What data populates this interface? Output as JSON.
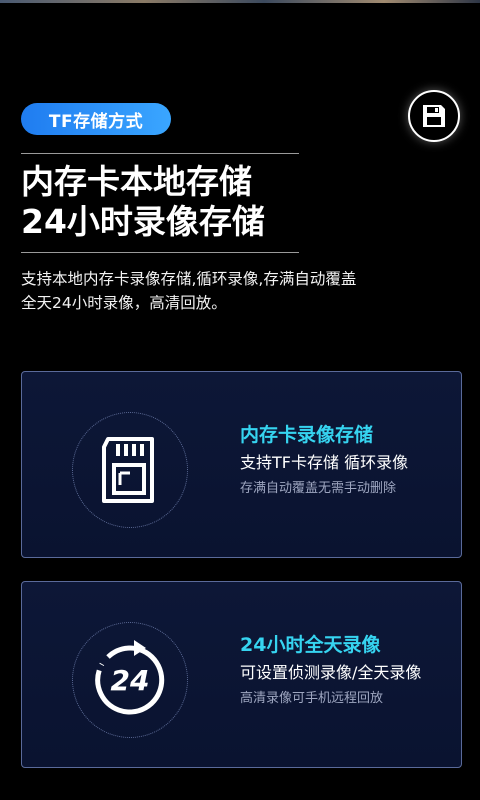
{
  "badge": {
    "label": "TF存储方式"
  },
  "save_button": {
    "icon": "floppy-disk-icon"
  },
  "headline": {
    "line1": "内存卡本地存储",
    "line2": "24小时录像存储"
  },
  "description": {
    "line1": "支持本地内存卡录像存储,循环录像,存满自动覆盖",
    "line2": "全天24小时录像，高清回放。"
  },
  "cards": [
    {
      "icon": "sd-card-icon",
      "title": "内存卡录像存储",
      "subtitle": "支持TF卡存储 循环录像",
      "note": "存满自动覆盖无需手动删除"
    },
    {
      "icon": "24-hour-clock-icon",
      "icon_text": "24",
      "title": "24小时全天录像",
      "subtitle": "可设置侦测录像/全天录像",
      "note": "高清录像可手机远程回放"
    }
  ],
  "colors": {
    "accent_blue": "#1f7cf0",
    "title_cyan": "#36d4f0",
    "card_bg": "#0d1737",
    "card_border": "#5a6a9a"
  }
}
